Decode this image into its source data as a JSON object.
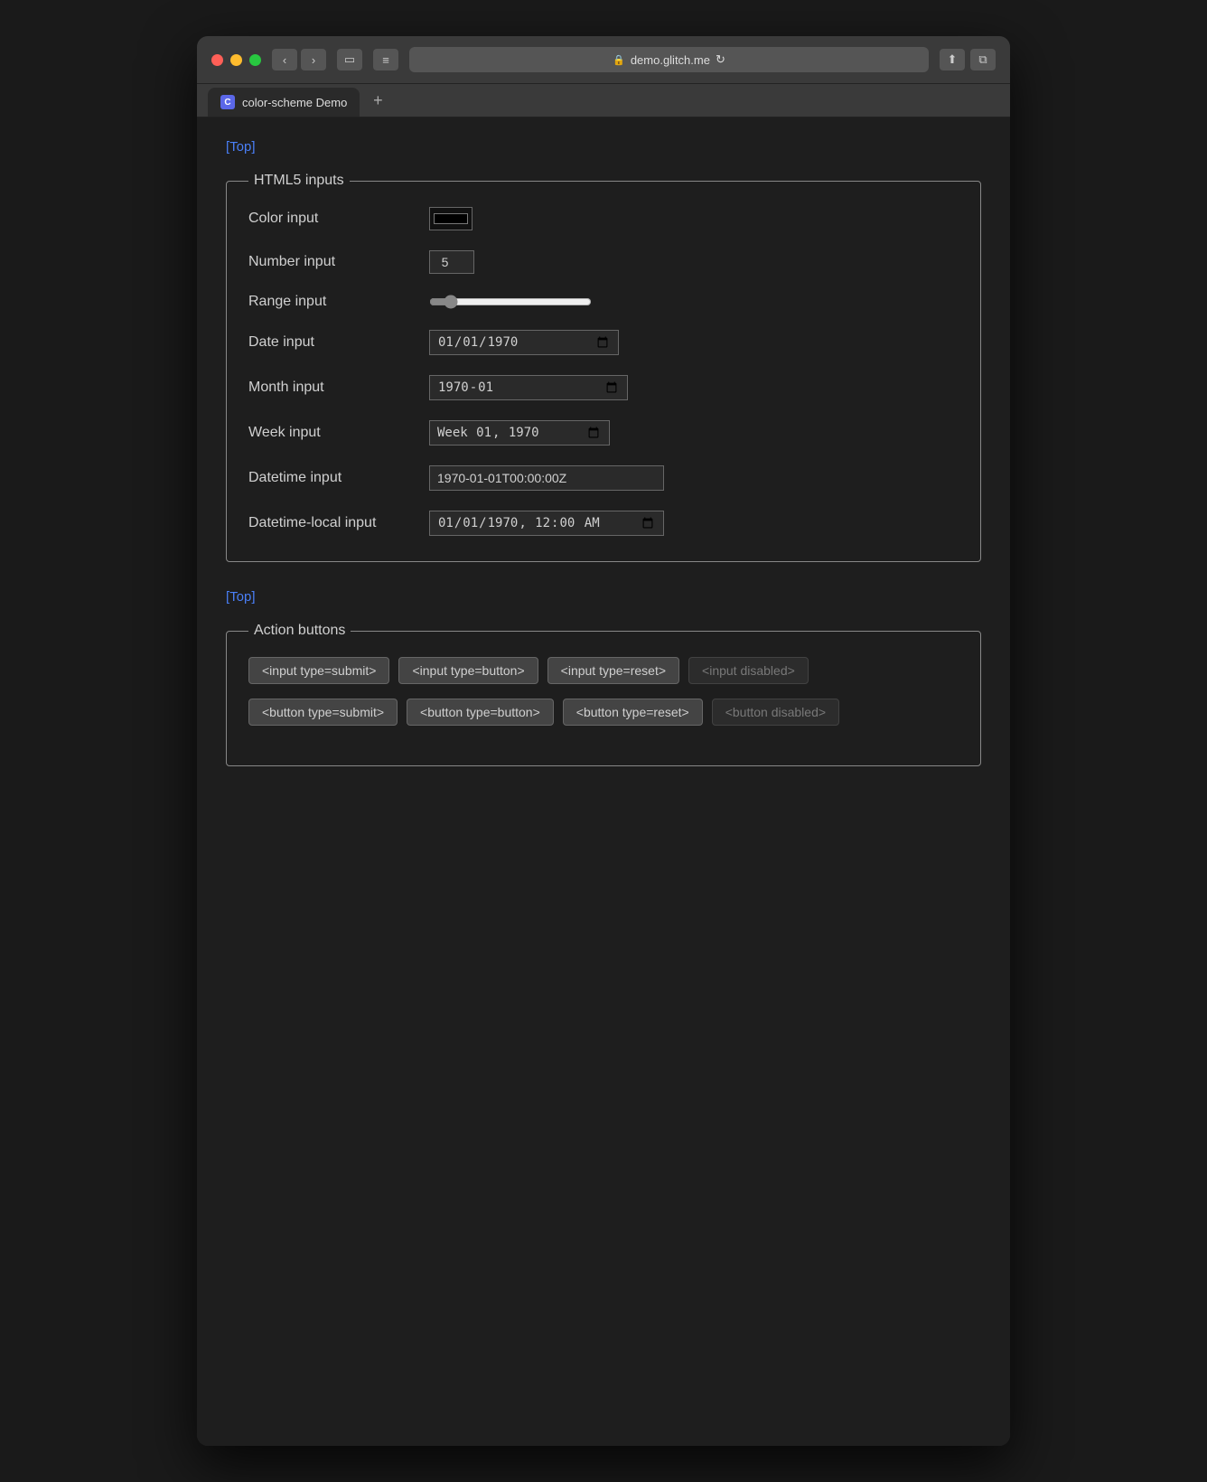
{
  "browser": {
    "url": "demo.glitch.me",
    "tab_title": "color-scheme Demo",
    "tab_favicon_letter": "C",
    "reload_icon": "↻",
    "back_icon": "‹",
    "forward_icon": "›",
    "sidebar_icon": "▭",
    "hamburger_icon": "≡",
    "share_icon": "⬆",
    "tab_icon": "⧉",
    "new_tab_icon": "+",
    "lock_icon": "🔒"
  },
  "page": {
    "top_link": "[Top]",
    "sections": {
      "html5_inputs": {
        "legend": "HTML5 inputs",
        "color_label": "Color input",
        "color_value": "#000000",
        "number_label": "Number input",
        "number_value": "5",
        "range_label": "Range input",
        "range_value": "10",
        "date_label": "Date input",
        "date_value": "1970-01-01",
        "month_label": "Month input",
        "month_value": "1970-01",
        "week_label": "Week input",
        "week_value": "1970-W01",
        "datetime_label": "Datetime input",
        "datetime_value": "1970-01-01T00:00:00Z",
        "datetime_local_label": "Datetime-local input",
        "datetime_local_value": "1970-01-01T00:00"
      },
      "action_buttons": {
        "legend": "Action buttons",
        "input_submit": "<input type=submit>",
        "input_button": "<input type=button>",
        "input_reset": "<input type=reset>",
        "input_disabled": "<input disabled>",
        "button_submit": "<button type=submit>",
        "button_button": "<button type=button>",
        "button_reset": "<button type=reset>",
        "button_disabled": "<button disabled>"
      }
    }
  }
}
